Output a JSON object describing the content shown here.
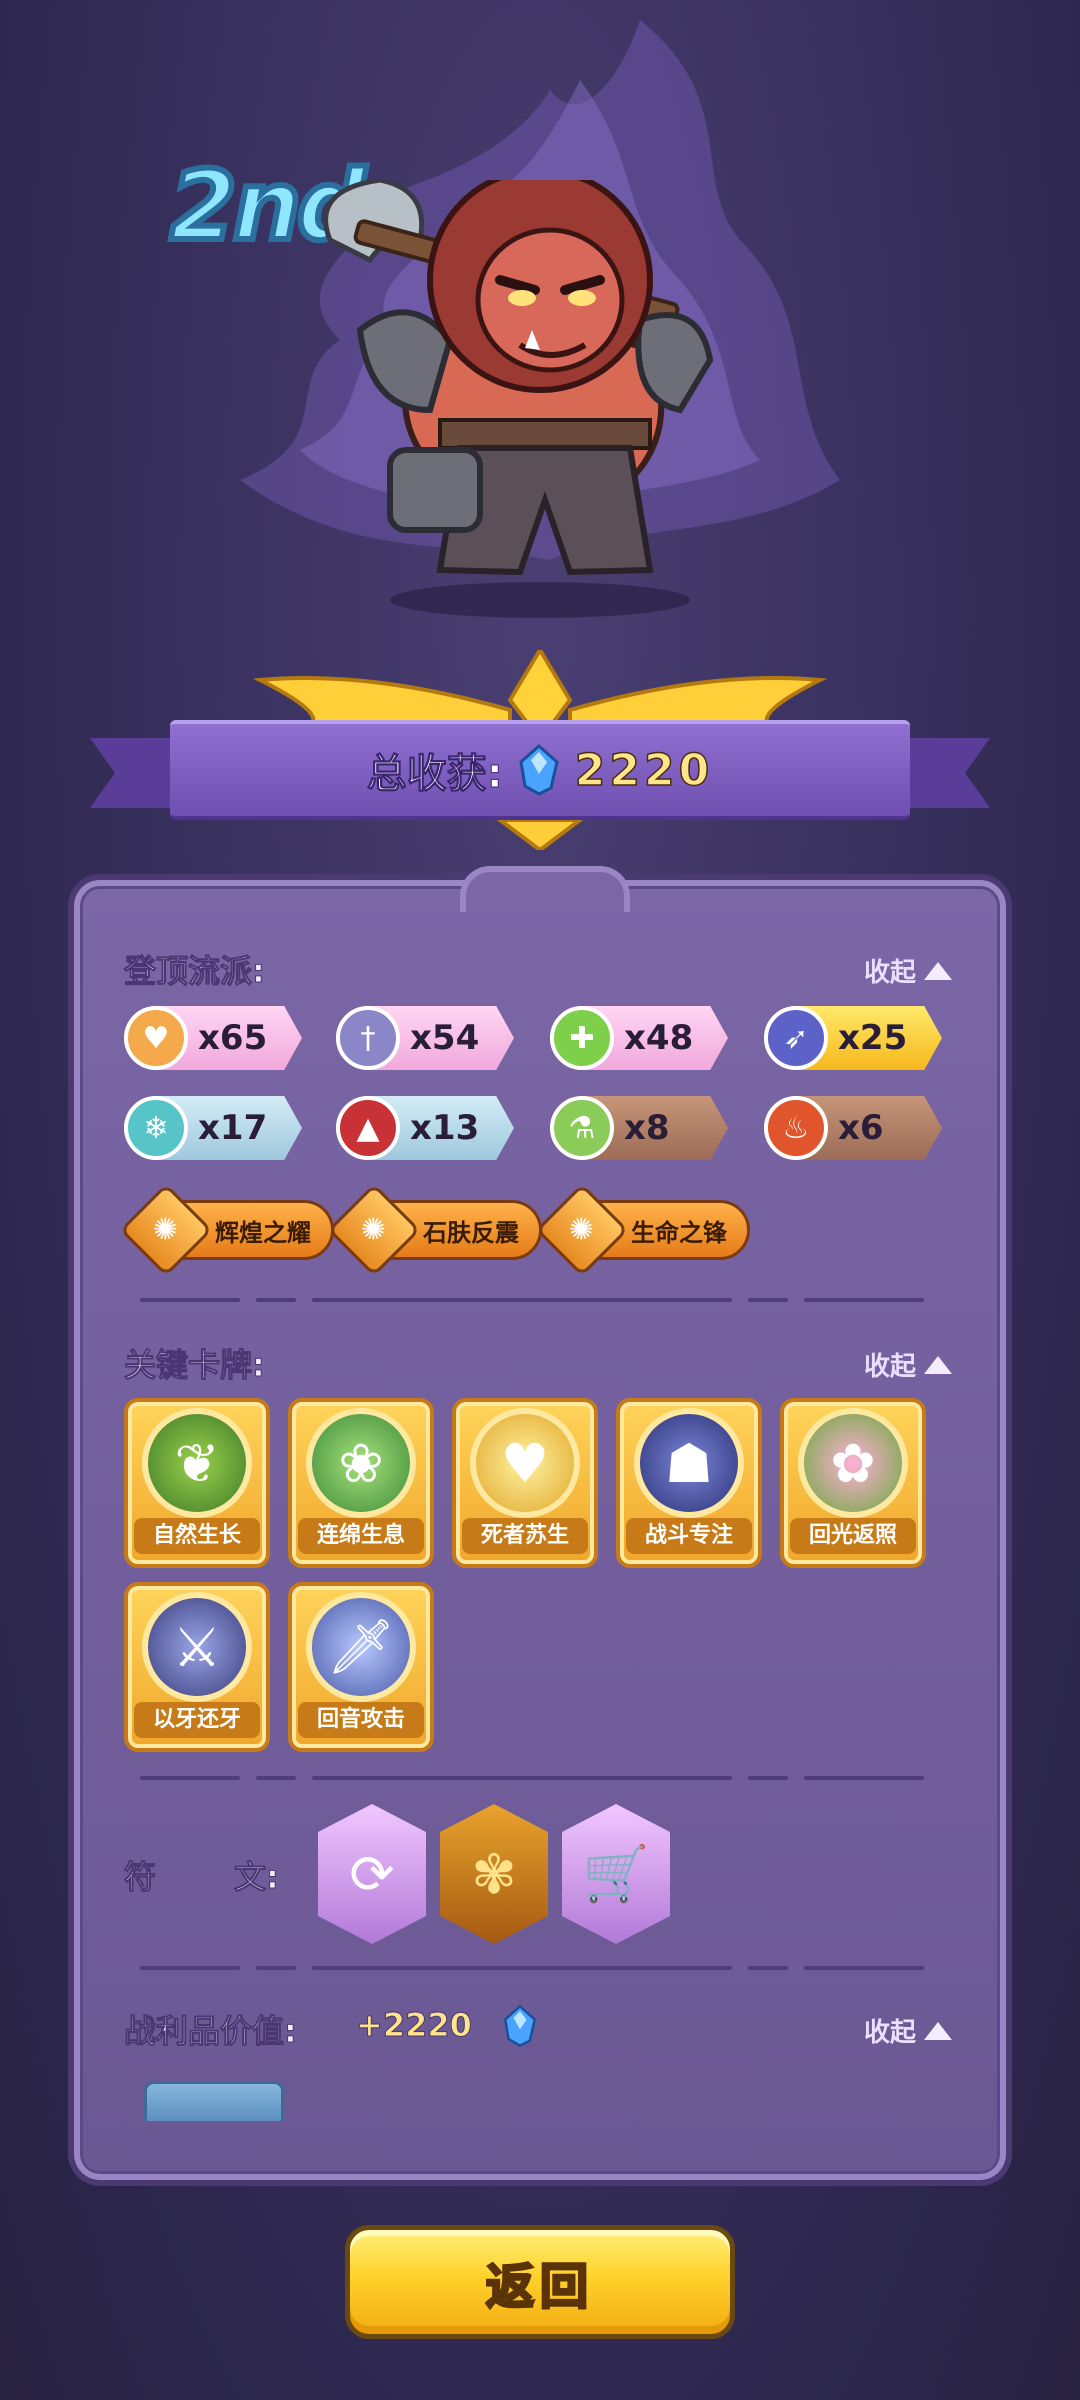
{
  "hero": {
    "rank": "2nd"
  },
  "banner": {
    "total_label": "总收获:",
    "total_value": "2220"
  },
  "build": {
    "title": "登顶流派:",
    "collapse": "收起",
    "tags": [
      {
        "icon": "heart-icon",
        "count": "x65",
        "style": "pink"
      },
      {
        "icon": "sword-icon",
        "count": "x54",
        "style": "pink"
      },
      {
        "icon": "plus-icon",
        "count": "x48",
        "style": "pink"
      },
      {
        "icon": "boot-icon",
        "count": "x25",
        "style": "gold"
      },
      {
        "icon": "snowflake-icon",
        "count": "x17",
        "style": "blue"
      },
      {
        "icon": "thorns-icon",
        "count": "x13",
        "style": "blue"
      },
      {
        "icon": "potion-icon",
        "count": "x8",
        "style": "brown"
      },
      {
        "icon": "fire-icon",
        "count": "x6",
        "style": "brown"
      }
    ],
    "traits": [
      "辉煌之耀",
      "石肤反震",
      "生命之锋"
    ]
  },
  "cards": {
    "title": "关键卡牌:",
    "collapse": "收起",
    "items": [
      "自然生长",
      "连绵生息",
      "死者苏生",
      "战斗专注",
      "回光返照",
      "以牙还牙",
      "回音攻击"
    ]
  },
  "runes": {
    "label_a": "符",
    "label_b": "文:",
    "items": [
      "refresh-rune-icon",
      "rose-rune-icon",
      "cart-rune-icon"
    ]
  },
  "loot": {
    "title": "战利品价值:",
    "value": "+2220",
    "collapse": "收起"
  },
  "footer": {
    "back_label": "返回"
  },
  "colors": {
    "accent_gold": "#ffd12a",
    "panel": "#7b66a6",
    "background": "#3a3260"
  }
}
